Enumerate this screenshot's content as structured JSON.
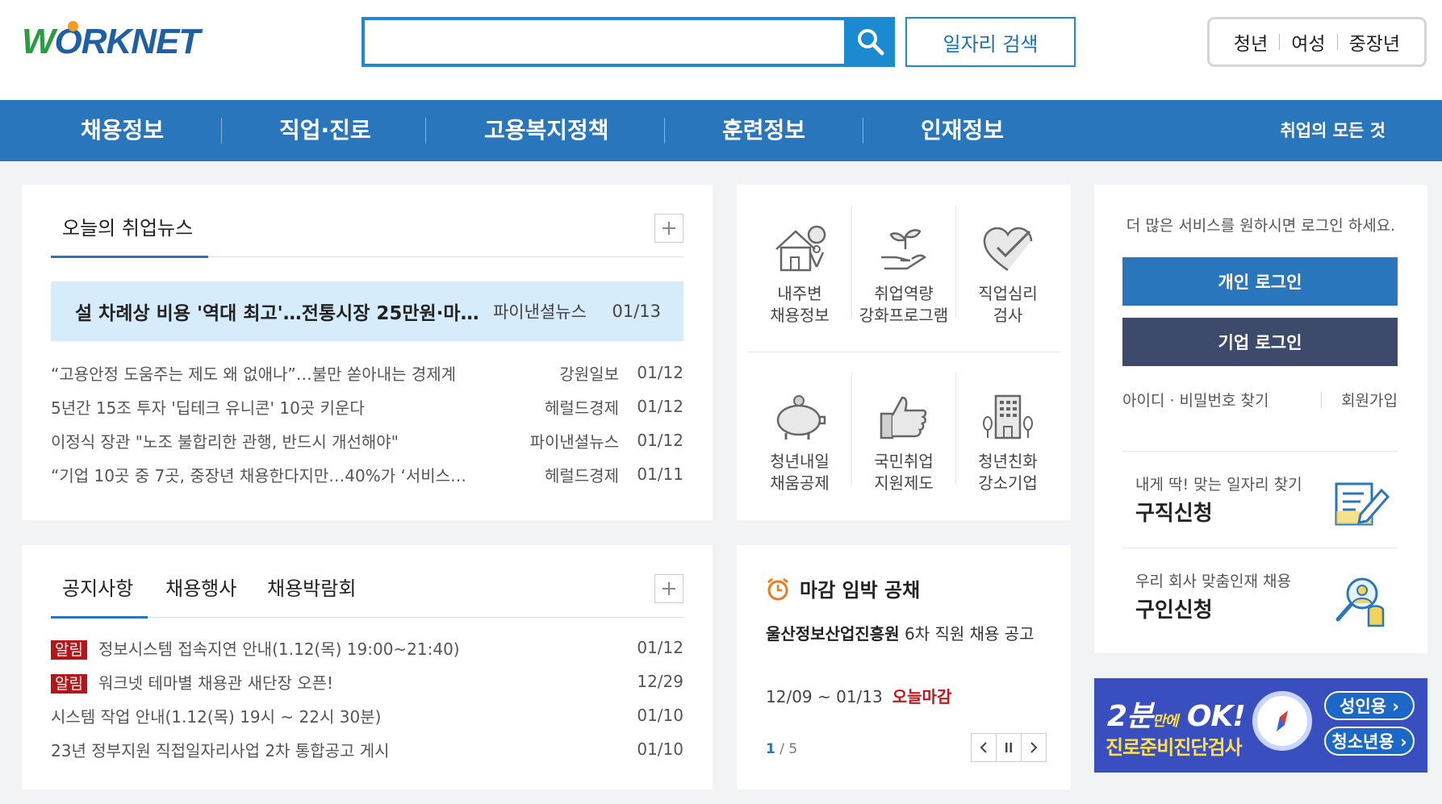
{
  "header": {
    "logo_text": "WORKNET",
    "search_placeholder": "",
    "job_search_label": "일자리 검색",
    "audience": [
      "청년",
      "여성",
      "중장년"
    ]
  },
  "nav": {
    "items": [
      "채용정보",
      "직업·진로",
      "고용복지정책",
      "훈련정보",
      "인재정보"
    ],
    "all_label": "취업의 모든 것"
  },
  "news": {
    "title": "오늘의 취업뉴스",
    "headline": {
      "title": "설 차례상 비용 '역대 최고'…전통시장 25만원·마…",
      "source": "파이낸셜뉴스",
      "date": "01/13"
    },
    "items": [
      {
        "title": "“고용안정 도움주는 제도 왜 없애나”…불만 쏟아내는 경제계",
        "source": "강원일보",
        "date": "01/12"
      },
      {
        "title": "5년간 15조 투자 '딥테크 유니콘' 10곳 키운다",
        "source": "헤럴드경제",
        "date": "01/12"
      },
      {
        "title": "이정식 장관 \"노조 불합리한 관행, 반드시 개선해야\"",
        "source": "파이낸셜뉴스",
        "date": "01/12"
      },
      {
        "title": "“기업 10곳 중 7곳, 중장년 채용한다지만…40%가 ‘서비스…",
        "source": "헤럴드경제",
        "date": "01/11"
      }
    ]
  },
  "services": [
    {
      "icon": "house-location-icon",
      "label": [
        "내주변",
        "채용정보"
      ]
    },
    {
      "icon": "hand-sprout-icon",
      "label": [
        "취업역량",
        "강화프로그램"
      ]
    },
    {
      "icon": "heart-check-icon",
      "label": [
        "직업심리",
        "검사"
      ]
    },
    {
      "icon": "piggy-bank-icon",
      "label": [
        "청년내일",
        "채움공제"
      ]
    },
    {
      "icon": "thumbs-up-icon",
      "label": [
        "국민취업",
        "지원제도"
      ]
    },
    {
      "icon": "building-icon",
      "label": [
        "청년친화",
        "강소기업"
      ]
    }
  ],
  "login": {
    "message": "더 많은 서비스를 원하시면 로그인 하세요.",
    "personal_label": "개인 로그인",
    "company_label": "기업 로그인",
    "find_label": "아이디 · 비밀번호 찾기",
    "signup_label": "회원가입",
    "job_seek": {
      "sub": "내게 딱! 맞는 일자리 찾기",
      "title": "구직신청"
    },
    "job_offer": {
      "sub": "우리 회사 맞춤인재 채용",
      "title": "구인신청"
    }
  },
  "notice": {
    "tabs": [
      "공지사항",
      "채용행사",
      "채용박람회"
    ],
    "items": [
      {
        "badge": "알림",
        "title": "정보시스템 접속지연 안내(1.12(목) 19:00~21:40)",
        "date": "01/12"
      },
      {
        "badge": "알림",
        "title": "워크넷 테마별 채용관 새단장 오픈!",
        "date": "12/29"
      },
      {
        "badge": "",
        "title": "시스템 작업 안내(1.12(목) 19시 ~ 22시 30분)",
        "date": "01/10"
      },
      {
        "badge": "",
        "title": "23년 정부지원 직접일자리사업 2차 통합공고 게시",
        "date": "01/10"
      }
    ]
  },
  "deadline": {
    "title": "마감 임박 공채",
    "org": "울산정보산업진흥원",
    "desc": " 6차 직원 채용 공고",
    "dates": "12/09 ~ 01/13",
    "tag": "오늘마감",
    "page_current": "1",
    "page_total": " / 5"
  },
  "banner": {
    "line1_big": "2분",
    "line1_small": "만에",
    "line1_end": " OK!",
    "line2": "진로준비진단검사",
    "adult_label": "성인용 ›",
    "youth_label": "청소년용 ›"
  },
  "colors": {
    "brand_blue": "#2a76bd",
    "search_blue": "#1b8ad0",
    "company_btn": "#3d4a6b",
    "alert_red": "#b3151b"
  }
}
